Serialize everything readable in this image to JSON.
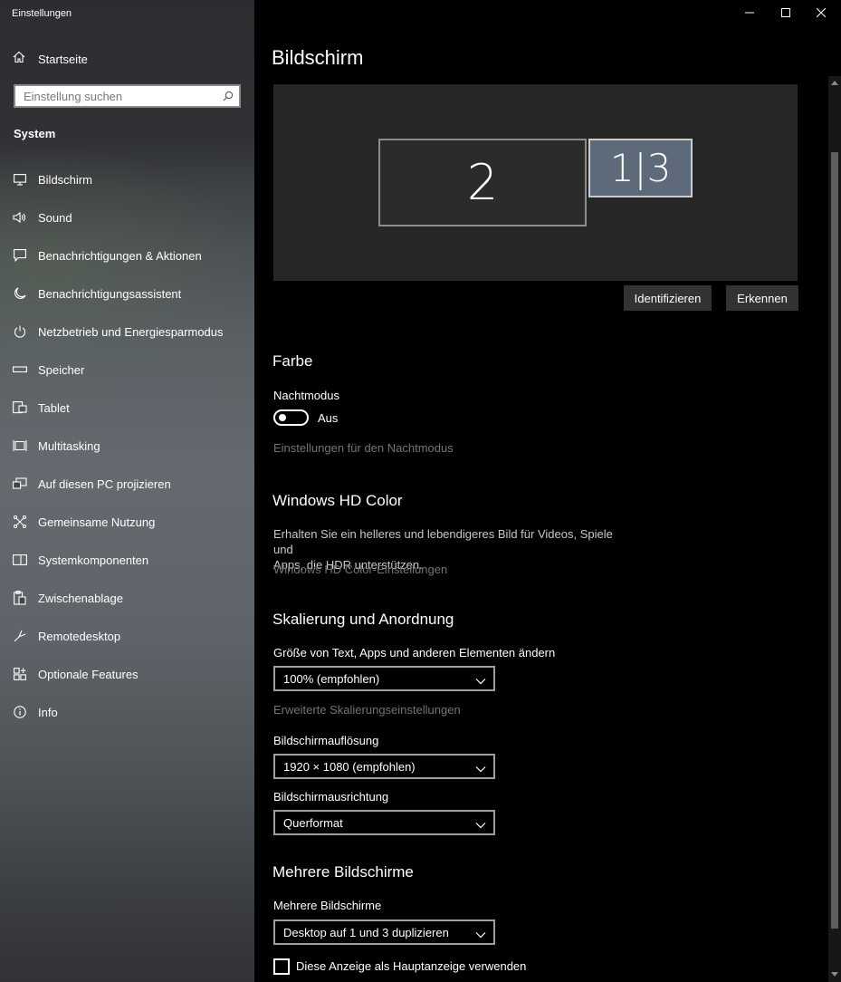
{
  "window": {
    "title": "Einstellungen",
    "controls": [
      "minimize-icon",
      "maximize-icon",
      "close-icon"
    ]
  },
  "sidebar": {
    "home_label": "Startseite",
    "search_placeholder": "Einstellung suchen",
    "section_label": "System",
    "items": [
      {
        "label": "Bildschirm",
        "icon": "monitor-icon"
      },
      {
        "label": "Sound",
        "icon": "speaker-icon"
      },
      {
        "label": "Benachrichtigungen & Aktionen",
        "icon": "message-icon"
      },
      {
        "label": "Benachrichtigungsassistent",
        "icon": "moon-icon"
      },
      {
        "label": "Netzbetrieb und Energiesparmodus",
        "icon": "power-icon"
      },
      {
        "label": "Speicher",
        "icon": "storage-icon"
      },
      {
        "label": "Tablet",
        "icon": "tablet-icon"
      },
      {
        "label": "Multitasking",
        "icon": "multitasking-icon"
      },
      {
        "label": "Auf diesen PC projizieren",
        "icon": "project-icon"
      },
      {
        "label": "Gemeinsame Nutzung",
        "icon": "share-icon"
      },
      {
        "label": "Systemkomponenten",
        "icon": "components-icon"
      },
      {
        "label": "Zwischenablage",
        "icon": "clipboard-icon"
      },
      {
        "label": "Remotedesktop",
        "icon": "remote-icon"
      },
      {
        "label": "Optionale Features",
        "icon": "features-icon"
      },
      {
        "label": "Info",
        "icon": "info-icon"
      }
    ]
  },
  "main": {
    "title": "Bildschirm",
    "monitors": [
      {
        "label": "2"
      },
      {
        "label": "1|3"
      }
    ],
    "buttons": {
      "identify": "Identifizieren",
      "detect": "Erkennen"
    },
    "color": {
      "heading": "Farbe",
      "night_label": "Nachtmodus",
      "night_state": "Aus",
      "night_link": "Einstellungen für den Nachtmodus"
    },
    "hdr": {
      "heading": "Windows HD Color",
      "desc_line1": "Erhalten Sie ein helleres und lebendigeres Bild für Videos, Spiele und",
      "desc_line2": "Apps, die HDR unterstützen.",
      "link": "Windows HD Color-Einstellungen"
    },
    "scale": {
      "heading": "Skalierung und Anordnung",
      "size_label": "Größe von Text, Apps und anderen Elementen ändern",
      "size_value": "100% (empfohlen)",
      "advanced_link": "Erweiterte Skalierungseinstellungen",
      "resolution_label": "Bildschirmauflösung",
      "resolution_value": "1920 × 1080 (empfohlen)",
      "orientation_label": "Bildschirmausrichtung",
      "orientation_value": "Querformat"
    },
    "multi": {
      "heading": "Mehrere Bildschirme",
      "label": "Mehrere Bildschirme",
      "value": "Desktop auf 1 und 3 duplizieren",
      "main_display_checkbox": "Diese Anzeige als Hauptanzeige verwenden"
    }
  },
  "colors": {
    "background": "#000000",
    "link": "#6f7478",
    "monitor_selected": "#5d6a7a",
    "button": "#333333"
  }
}
